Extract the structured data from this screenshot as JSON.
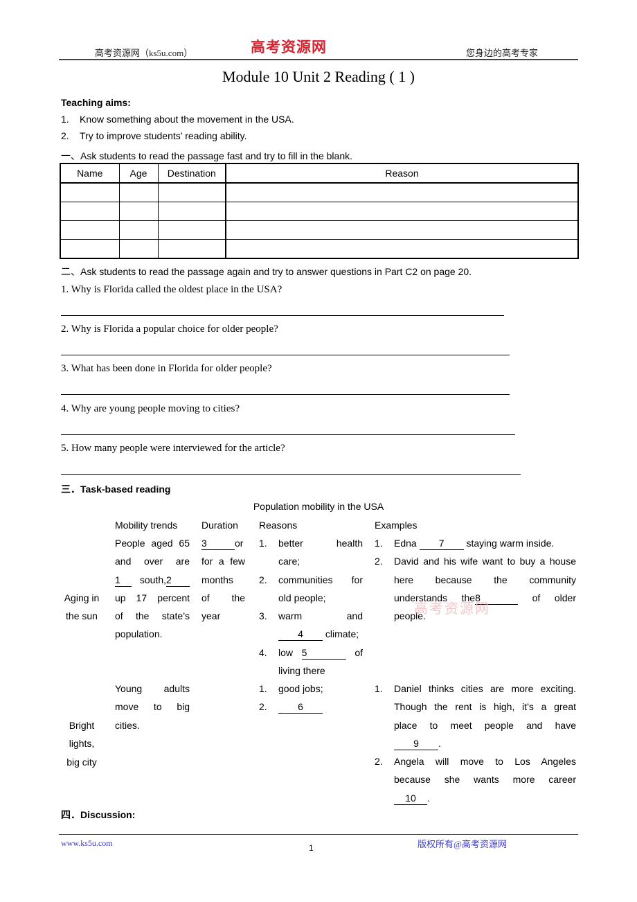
{
  "header": {
    "left": "高考资源网（ks5u.com）",
    "logo": "高考资源网",
    "right": "您身边的高考专家"
  },
  "title": "Module 10 Unit 2 Reading ( 1 )",
  "aims": {
    "heading": "Teaching aims:",
    "items": [
      {
        "num": "1.",
        "text": "Know something about the movement in the USA."
      },
      {
        "num": "2.",
        "text": "Try to improve students’ reading ability."
      }
    ]
  },
  "section1": {
    "label": "一、Ask students to read the passage fast and try to fill in the blank.",
    "table": {
      "headers": [
        "Name",
        "Age",
        "Destination",
        "Reason"
      ],
      "rows": [
        [
          "",
          "",
          "",
          ""
        ],
        [
          "",
          "",
          "",
          ""
        ],
        [
          "",
          "",
          "",
          ""
        ],
        [
          "",
          "",
          "",
          ""
        ]
      ]
    }
  },
  "section2": {
    "label": "二、Ask students to read the passage again and try to answer questions in Part C2 on page 20.",
    "questions": [
      "1. Why is Florida called the oldest place in the USA?",
      "2. Why is Florida a popular choice for older people?",
      "3. What has been done in Florida for older people?",
      "4. Why are young people moving to cities?",
      "5. How many people were interviewed for the article?"
    ]
  },
  "section3": {
    "label_prefix": "三．",
    "label": "Task-based reading",
    "table_title": "Population mobility in the USA",
    "columns": [
      "Mobility trends",
      "Duration",
      "Reasons",
      "Examples"
    ],
    "rows": [
      {
        "topic_line1": "Aging in",
        "topic_line2": "the sun",
        "trend": {
          "l1": "People aged 65",
          "l2": "and over are",
          "blank1": "1",
          "l3_mid": "south,",
          "blank2": "2",
          "l4": "up 17 percent",
          "l5": "of the state’s",
          "l6": "population."
        },
        "duration": {
          "blank3": "3",
          "l1_tail": "or",
          "l2": "for a few",
          "l3": "months",
          "l4": "of the",
          "l5": "year"
        },
        "reasons": [
          {
            "num": "1.",
            "l1": "better health",
            "l2": "care;"
          },
          {
            "num": "2.",
            "l1": "communities for",
            "l2": "old people;"
          },
          {
            "num": "3.",
            "l1": "warm and",
            "blank": "4",
            "l2_tail": "climate;"
          },
          {
            "num": "4.",
            "l1_head": "low",
            "blank": "5",
            "l1_tail": "of",
            "l2": "living there"
          }
        ],
        "examples": [
          {
            "num": "1.",
            "head": "Edna",
            "blank": "7",
            "tail": "staying warm inside."
          },
          {
            "num": "2.",
            "l1": "David and his wife want to buy a house",
            "l2": "here because the community",
            "l3_head": "understands the",
            "blank": "8",
            "l3_tail": "of older",
            "l4": "people."
          }
        ]
      },
      {
        "topic_line1": "Bright",
        "topic_line2": "lights,",
        "topic_line3": "big city",
        "trend": {
          "l1": "Young adults",
          "l2": "move to big",
          "l3": "cities."
        },
        "reasons": [
          {
            "num": "1.",
            "text": "good jobs;"
          },
          {
            "num": "2.",
            "blank": "6"
          }
        ],
        "examples": [
          {
            "num": "1.",
            "l1": "Daniel thinks cities are more exciting.",
            "l2": "Though the rent is high, it’s a great",
            "l3": "place to meet people and have",
            "blank": "9",
            "l4_tail": "."
          },
          {
            "num": "2.",
            "l1": "Angela will move to Los Angeles",
            "l2": "because she wants more career",
            "blank": "10",
            "l3_tail": "."
          }
        ]
      }
    ]
  },
  "section4": {
    "label_prefix": "四．",
    "label": "Discussion:"
  },
  "watermark": "高考资源网",
  "footer": {
    "left": "www.ks5u.com",
    "page": "1",
    "right": "版权所有@高考资源网"
  }
}
